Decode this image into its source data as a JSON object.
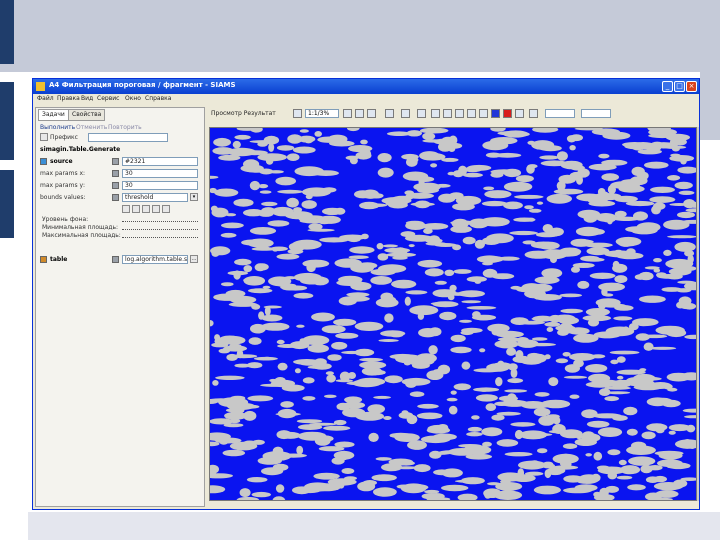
{
  "window": {
    "title": "A4 Фильтрация пороговая / фрагмент - SIAMS",
    "menu": [
      "Файл",
      "Правка",
      "Вид",
      "Сервис",
      "Окно",
      "Справка"
    ],
    "buttons": {
      "minimize": "_",
      "maximize": "□",
      "close": "×"
    }
  },
  "panel": {
    "tabs": [
      "Задачи",
      "Свойства"
    ],
    "links": [
      "Выполнить",
      "Отменить",
      "Повторить"
    ],
    "prefix_label": "Префикс",
    "operation": "simagin.Table.Generate",
    "source_label": "source",
    "source_value": "#2321",
    "params": [
      {
        "label": "max params х:",
        "value": "30"
      },
      {
        "label": "max params у:",
        "value": "30"
      },
      {
        "label": "bounds values:",
        "value": "threshold"
      }
    ],
    "sliders": [
      "Уровень фона:",
      "Минимальная площадь:",
      "Максимальная площадь:"
    ],
    "table_label": "table",
    "table_value": "log.algorithm.table.stat"
  },
  "toolbar": {
    "label": "Просмотр Результат",
    "zoom": "1:1/3%",
    "accent_blue": "#2236d8",
    "accent_red": "#d81c1c"
  },
  "image": {
    "background": "#0a14f0",
    "blob_color": "#c8c8c8"
  }
}
